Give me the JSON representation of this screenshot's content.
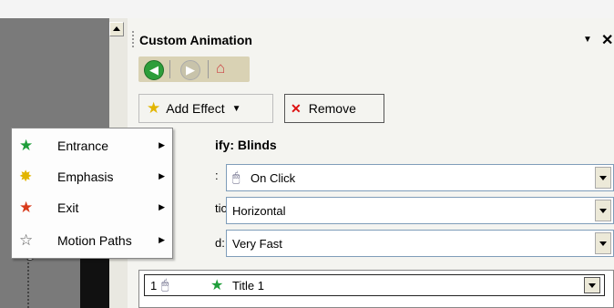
{
  "pane": {
    "title": "Custom Animation",
    "dropdown_glyph": "▼",
    "close_glyph": "✕"
  },
  "nav": {
    "back_glyph": "◀",
    "forward_glyph": "▶",
    "home_glyph": "⌂",
    "icons": [
      "back-arrow-icon",
      "forward-arrow-icon",
      "home-icon"
    ]
  },
  "toolbar": {
    "add_effect_label": "Add Effect",
    "add_effect_arrow": "▼",
    "remove_label": "Remove",
    "star_glyph": "★",
    "remove_glyph": "✕"
  },
  "modify": {
    "heading": "ify: Blinds",
    "start_label": ":",
    "direction_label": "tion:",
    "speed_label": "d:",
    "start_value": "On Click",
    "direction_value": "Horizontal",
    "speed_value": "Very Fast"
  },
  "list": {
    "items": [
      {
        "number": "1",
        "title": "Title 1",
        "mouse_glyph": "🖱",
        "star_glyph": "★"
      }
    ]
  },
  "menu": {
    "items": [
      {
        "label": "Entrance",
        "icon": "entrance-star-icon",
        "glyph": "★",
        "color": "#1e9e3a",
        "submenu_glyph": "▶"
      },
      {
        "label": "Emphasis",
        "icon": "emphasis-star-icon",
        "glyph": "✸",
        "color": "#e2b500",
        "submenu_glyph": "▶"
      },
      {
        "label": "Exit",
        "icon": "exit-star-icon",
        "glyph": "★",
        "color": "#d83b1b",
        "submenu_glyph": "▶"
      },
      {
        "label": "Motion Paths",
        "icon": "motion-path-star-icon",
        "glyph": "☆",
        "color": "#555555",
        "submenu_glyph": "▶"
      }
    ]
  },
  "colors": {
    "pane_bg": "#f4f4f0",
    "accent_green": "#2d9e3a",
    "field_border": "#7f9db9"
  }
}
